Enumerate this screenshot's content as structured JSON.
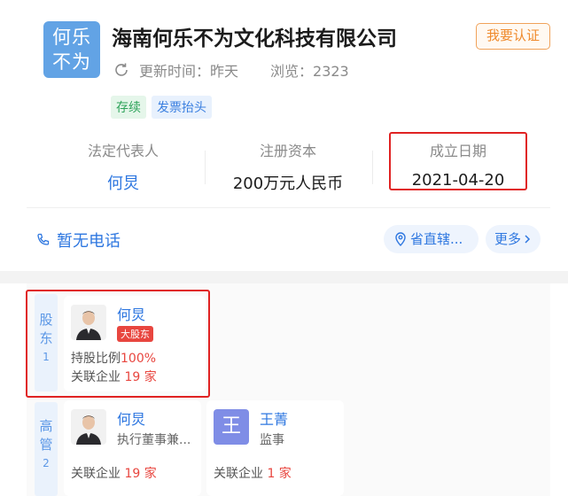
{
  "company": {
    "logo_lines": [
      "何乐",
      "不为"
    ],
    "name": "海南何乐不为文化科技有限公司",
    "claim_label": "我要认证",
    "updated": "更新时间：昨天",
    "views": "浏览：2323",
    "tags": [
      "存续",
      "发票抬头"
    ]
  },
  "info": {
    "legal_rep_label": "法定代表人",
    "legal_rep_value": "何炅",
    "capital_label": "注册资本",
    "capital_value": "200万元人民币",
    "founded_label": "成立日期",
    "founded_value": "2021-04-20"
  },
  "contact": {
    "phone": "暂无电话",
    "region": "省直辖...",
    "more": "更多"
  },
  "shareholders": {
    "side_chars": [
      "股",
      "东"
    ],
    "count": "1",
    "items": [
      {
        "name": "何炅",
        "badge": "大股东",
        "share_label": "持股比例",
        "share_value": "100%",
        "related_label": "关联企业",
        "related_value": "19 家"
      }
    ]
  },
  "executives": {
    "side_chars": [
      "高",
      "管"
    ],
    "count": "2",
    "items": [
      {
        "name": "何炅",
        "role": "执行董事兼...",
        "related_label": "关联企业",
        "related_value": "19 家"
      },
      {
        "name": "王菁",
        "avatar_letter": "王",
        "role": "监事",
        "related_label": "关联企业",
        "related_value": "1 家"
      }
    ]
  },
  "colors": {
    "accent_blue": "#2e77e0",
    "logo_bg": "#62a3e5",
    "highlight_red": "#e02222",
    "claim_orange": "#ef8a2c"
  }
}
